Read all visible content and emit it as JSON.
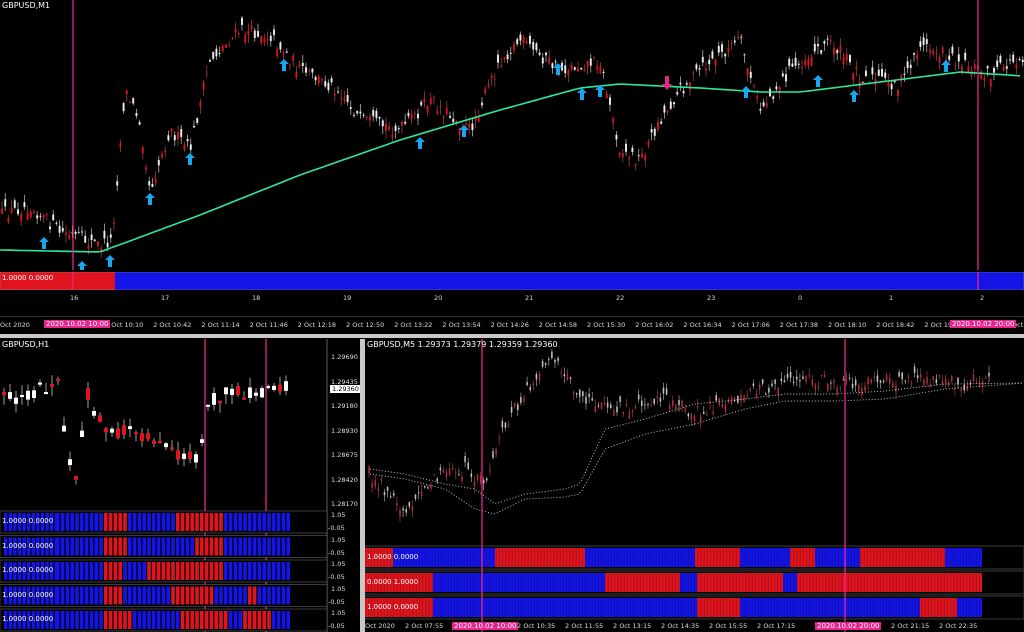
{
  "colors": {
    "bull": "#ffffff",
    "bear": "#e0141e",
    "ma": "#2ee89a",
    "arrow_up": "#18a6ef",
    "arrow_down": "#e8258c",
    "vline": "#e8258c",
    "ind_red": "#e0141e",
    "ind_blue": "#1414e6",
    "dots": "#cfcfcf"
  },
  "top_chart": {
    "symbol": "GBPUSD,M1",
    "indicator_text": "1.0000 0.0000",
    "sub_ticks": [
      "16",
      "17",
      "18",
      "19",
      "20",
      "21",
      "22",
      "23",
      "0",
      "1",
      "2"
    ],
    "time_ticks": [
      "Oct 2020",
      "2 Oct 10:10",
      "2 Oct 10:42",
      "2 Oct 11:14",
      "2 Oct 11:46",
      "2 Oct 12:18",
      "2 Oct 12:50",
      "2 Oct 13:22",
      "2 Oct 13:54",
      "2 Oct 14:26",
      "2 Oct 14:58",
      "2 Oct 15:30",
      "2 Oct 16:02",
      "2 Oct 16:34",
      "2 Oct 17:06",
      "2 Oct 17:38",
      "2 Oct 18:10",
      "2 Oct 18:42",
      "2 Oct 19:14",
      "Oct"
    ],
    "tag_left": "2020.10.02 10:00",
    "tag_right": "2020.10.02 20:00"
  },
  "left_chart": {
    "symbol": "GBPUSD,H1",
    "prices": [
      "1.29690",
      "1.29435",
      "1.29180",
      "1.28930",
      "1.28675",
      "1.28420",
      "1.28170"
    ],
    "current_price": "1.29360",
    "indicators": [
      {
        "text": "1.0000 0.0000",
        "scale_top": "1.05",
        "scale_bottom": "-0.05",
        "pattern": [
          0,
          0,
          0,
          0,
          0,
          0,
          0,
          0,
          0,
          0,
          1,
          1,
          1,
          1,
          1,
          0,
          0,
          0,
          0,
          0,
          0,
          0,
          0,
          0,
          0,
          1,
          1,
          1,
          1,
          1,
          1,
          1,
          1,
          1,
          1,
          0,
          0,
          0,
          0,
          0,
          0,
          0,
          0,
          0,
          0,
          0,
          0,
          0,
          0
        ]
      },
      {
        "text": "1.0000 0.0000",
        "scale_top": "1.05",
        "scale_bottom": "-0.05",
        "pattern": [
          0,
          0,
          0,
          0,
          0,
          0,
          0,
          0,
          0,
          0,
          1,
          1,
          1,
          1,
          1,
          0,
          0,
          0,
          0,
          0,
          0,
          0,
          0,
          0,
          0,
          0,
          0,
          0,
          0,
          1,
          1,
          1,
          1,
          1,
          1,
          0,
          0,
          0,
          0,
          0,
          0,
          0,
          0,
          0,
          0,
          0,
          0,
          0,
          0
        ]
      },
      {
        "text": "1.0000 0.0000",
        "scale_top": "1.05",
        "scale_bottom": "-0.05",
        "pattern": [
          0,
          0,
          0,
          0,
          0,
          0,
          0,
          0,
          0,
          0,
          1,
          1,
          1,
          1,
          0,
          0,
          0,
          0,
          0,
          1,
          1,
          1,
          1,
          1,
          1,
          1,
          1,
          1,
          1,
          1,
          1,
          1,
          1,
          1,
          1,
          0,
          0,
          0,
          0,
          0,
          0,
          0,
          0,
          0,
          0,
          0,
          0,
          0,
          0
        ]
      },
      {
        "text": "1.0000 0.0000",
        "scale_top": "1.05",
        "scale_bottom": "-0.05",
        "pattern": [
          0,
          0,
          0,
          0,
          0,
          0,
          0,
          0,
          0,
          0,
          1,
          1,
          1,
          1,
          0,
          0,
          0,
          0,
          0,
          0,
          0,
          0,
          0,
          0,
          1,
          1,
          1,
          1,
          1,
          1,
          1,
          1,
          1,
          0,
          0,
          0,
          0,
          0,
          0,
          0,
          1,
          1,
          0,
          0,
          0,
          0,
          0,
          0,
          0
        ]
      },
      {
        "text": "1.0000 0.0000",
        "scale_top": "1.05",
        "scale_bottom": "-0.05",
        "pattern": [
          0,
          0,
          0,
          0,
          0,
          0,
          0,
          0,
          0,
          0,
          1,
          1,
          1,
          1,
          1,
          1,
          0,
          0,
          0,
          0,
          0,
          0,
          0,
          0,
          0,
          0,
          1,
          1,
          1,
          1,
          1,
          1,
          1,
          1,
          1,
          1,
          0,
          0,
          0,
          1,
          1,
          1,
          1,
          1,
          1,
          0,
          0,
          0,
          0
        ]
      }
    ]
  },
  "right_chart": {
    "symbol": "GBPUSD,M5  1.29373 1.29379 1.29359 1.29360",
    "indicators": [
      {
        "text": "1.0000 0.0000"
      },
      {
        "text": "0.0000 1.0000"
      },
      {
        "text": "1.0000 0.0000"
      }
    ],
    "time_ticks": [
      "Oct 2020",
      "2 Oct 07:55",
      "2 Oct 10:35",
      "2 Oct 11:55",
      "2 Oct 13:15",
      "2 Oct 14:35",
      "2 Oct 15:55",
      "2 Oct 17:15",
      "2 Oct 21:15",
      "2 Oct 22:35"
    ],
    "tag_left": "2020.10.02 10:00",
    "tag_right": "2020.10.02 20:00"
  }
}
